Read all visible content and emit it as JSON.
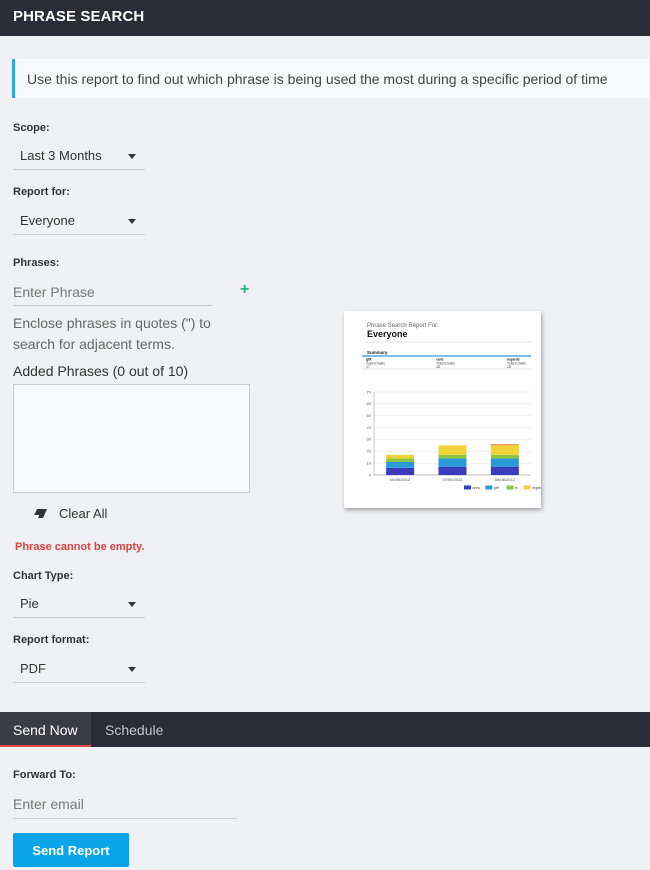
{
  "header": {
    "title": "PHRASE SEARCH"
  },
  "info": {
    "text": "Use this report to find out which phrase is being used the most during a specific period of time"
  },
  "scope": {
    "label": "Scope:",
    "value": "Last 3 Months"
  },
  "report_for": {
    "label": "Report for:",
    "value": "Everyone"
  },
  "phrases": {
    "label": "Phrases:",
    "placeholder": "Enter Phrase",
    "hint": "Enclose phrases in quotes (\") to search for adjacent terms.",
    "added_label": "Added Phrases  (0 out of 10)",
    "clear_all": "Clear All",
    "error": "Phrase cannot be empty."
  },
  "chart_type": {
    "label": "Chart Type:",
    "value": "Pie"
  },
  "report_format": {
    "label": "Report format:",
    "value": "PDF"
  },
  "tabs": [
    {
      "label": "Send Now"
    },
    {
      "label": "Schedule"
    }
  ],
  "forward": {
    "label": "Forward To:",
    "placeholder": "Enter email"
  },
  "send_button": {
    "label": "Send Report"
  },
  "preview": {
    "report_title": "Phrase Search Report For:",
    "report_subject": "Everyone",
    "summary_label": "Summary",
    "summary_columns": [
      {
        "term": "gift",
        "line1": "Total Emails",
        "line2": "17"
      },
      {
        "term": "card",
        "line1": "Total Emails",
        "line2": "48"
      },
      {
        "term": "regards",
        "line1": "Total Emails",
        "line2": "18"
      }
    ]
  },
  "chart_data": {
    "type": "bar",
    "stacked": true,
    "categories": [
      "06/06/2012",
      "07/06/2012",
      "08/06/2012"
    ],
    "ylim": [
      0,
      70
    ],
    "yticks": [
      "70",
      "60",
      "50",
      "40",
      "30",
      "20",
      "10",
      "0"
    ],
    "series": [
      {
        "name": "area",
        "values": [
          6,
          7,
          7
        ],
        "color": "#3a3bbd"
      },
      {
        "name": "gift",
        "values": [
          5,
          7,
          7
        ],
        "color": "#2a9ad8"
      },
      {
        "name": "hi",
        "values": [
          3,
          3,
          3
        ],
        "color": "#8cc63f"
      },
      {
        "name": "regards",
        "values": [
          3,
          8,
          8
        ],
        "color": "#f2d23b"
      },
      {
        "name": "",
        "values": [
          0,
          0,
          1
        ],
        "color": "#f08c2e"
      }
    ],
    "grid": true,
    "legend": "bottom-right"
  },
  "colors": {
    "accent": "#0aa5e8",
    "header_bg": "#2a2d36",
    "error": "#e0413b",
    "tab_underline": "#e04a4a",
    "add_icon": "#2db37d"
  }
}
